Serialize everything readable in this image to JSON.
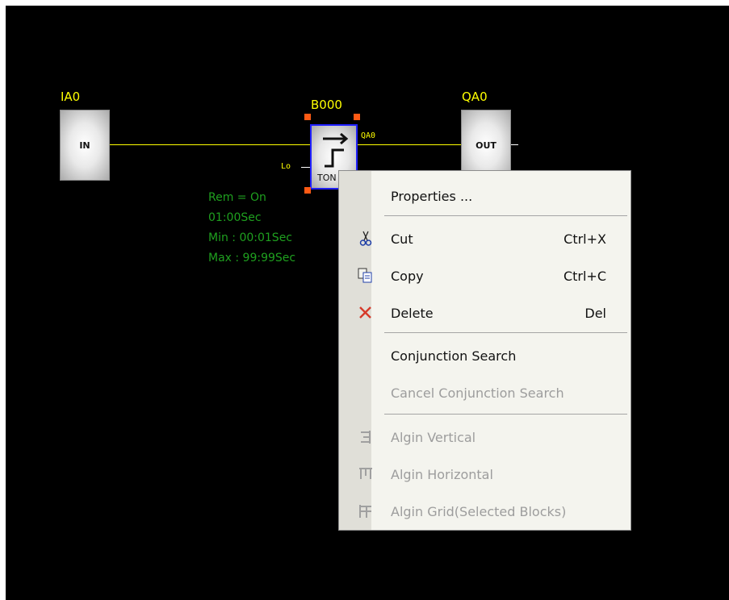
{
  "diagram": {
    "blocks": {
      "ia0": {
        "name": "IA0",
        "inner": "IN"
      },
      "b000": {
        "name": "B000",
        "inner": "TON",
        "out_pin": "QA0",
        "in_pin": "Lo"
      },
      "qa0": {
        "name": "QA0",
        "inner": "OUT"
      }
    },
    "params": [
      "Rem = On",
      "01:00Sec",
      "Min : 00:01Sec",
      "Max : 99:99Sec"
    ],
    "colors": {
      "wire": "#ffff00",
      "params_text": "#1fa01f",
      "selection_handle": "#ff5a14",
      "selected_border": "#2020ff"
    }
  },
  "context_menu": {
    "items": [
      {
        "label": "Properties ...",
        "shortcut": "",
        "icon": "",
        "enabled": true
      },
      {
        "label": "Cut",
        "shortcut": "Ctrl+X",
        "icon": "scissors-icon",
        "enabled": true
      },
      {
        "label": "Copy",
        "shortcut": "Ctrl+C",
        "icon": "copy-icon",
        "enabled": true
      },
      {
        "label": "Delete",
        "shortcut": "Del",
        "icon": "delete-x-icon",
        "enabled": true
      },
      {
        "label": "Conjunction Search",
        "shortcut": "",
        "icon": "",
        "enabled": true
      },
      {
        "label": "Cancel Conjunction Search",
        "shortcut": "",
        "icon": "",
        "enabled": false
      },
      {
        "label": "Algin Vertical",
        "shortcut": "",
        "icon": "align-vertical-icon",
        "enabled": false
      },
      {
        "label": "Algin Horizontal",
        "shortcut": "",
        "icon": "align-horizontal-icon",
        "enabled": false
      },
      {
        "label": "Algin Grid(Selected Blocks)",
        "shortcut": "",
        "icon": "align-grid-icon",
        "enabled": false
      }
    ]
  }
}
